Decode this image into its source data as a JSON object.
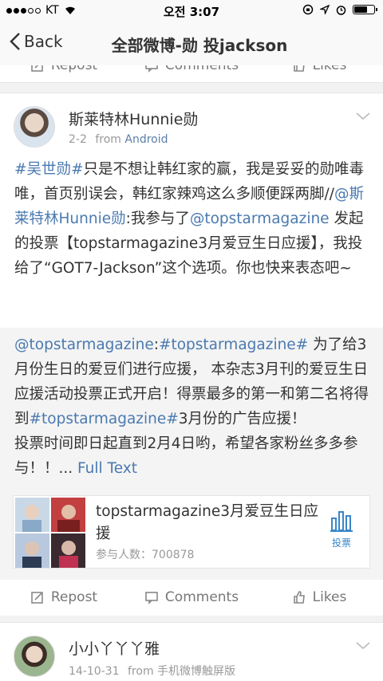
{
  "status_bar": {
    "carrier": "KT",
    "time": "오전 3:07"
  },
  "nav": {
    "back_label": "Back",
    "title": "全部微博-勋 投jackson"
  },
  "actions": {
    "repost": "Repost",
    "comments": "Comments",
    "likes": "Likes"
  },
  "post": {
    "user": "斯莱特林Hunnie勋",
    "date": "2-2",
    "from_label": "from",
    "source": "Android",
    "text_parts": [
      {
        "t": "#吴世勋#",
        "link": true
      },
      {
        "t": "只是不想让韩红家的赢，我是妥妥的勋唯毒唯，首页别误会，韩红家辣鸡这么多顺便踩两脚//",
        "link": false
      },
      {
        "t": "@斯莱特林Hunnie勋",
        "link": true
      },
      {
        "t": ":我参与了",
        "link": false
      },
      {
        "t": "@topstarmagazine",
        "link": true
      },
      {
        "t": " 发起的投票【topstarmagazine3月爱豆生日应援】，我投给了“GOT7-Jackson”这个选项。你也快来表态吧~",
        "link": false
      }
    ],
    "repost": {
      "text_parts": [
        {
          "t": "@topstarmagazine",
          "link": true
        },
        {
          "t": ":",
          "link": false
        },
        {
          "t": "#topstarmagazine#",
          "link": true
        },
        {
          "t": " 为了给3月份生日的爱豆们进行应援， 本杂志3月刊的爱豆生日应援活动投票正式开启！得票最多的第一和第二名将得到",
          "link": false
        },
        {
          "t": "#topstarmagazine#",
          "link": true
        },
        {
          "t": "3月份的广告应援！",
          "link": false
        },
        {
          "t": "\n投票时间即日起直到2月4日哟，希望各家粉丝多多参与！！... ",
          "link": false
        },
        {
          "t": "Full Text",
          "link": true
        }
      ],
      "vote": {
        "title": "topstarmagazine3月爱豆生日应援",
        "count": "参与人数：700878",
        "button_label": "投票"
      }
    }
  },
  "next_post": {
    "user": "小小丫丫丫雅",
    "date": "14-10-31",
    "from_label": "from",
    "source": "手机微博触屏版"
  }
}
